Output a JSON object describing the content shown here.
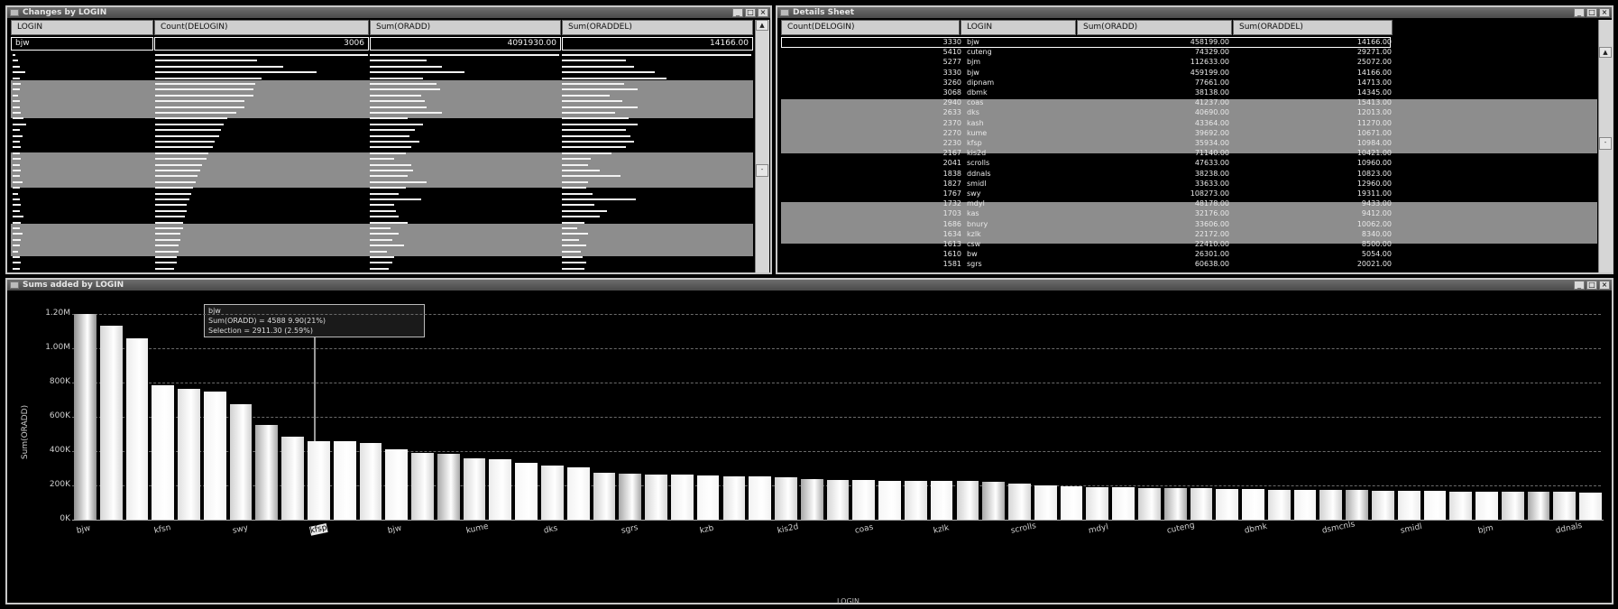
{
  "top_left": {
    "title": "Changes by LOGIN",
    "columns": [
      "LOGIN",
      "Count(DELOGIN)",
      "Sum(ORADD)",
      "Sum(ORADDEL)"
    ],
    "selected_row": [
      "bjw",
      "3006",
      "4091930.00",
      "14166.00"
    ],
    "bars": [
      [
        0.02,
        1.0,
        1.0,
        1.0
      ],
      [
        0.04,
        0.48,
        0.3,
        0.34
      ],
      [
        0.05,
        0.6,
        0.38,
        0.38
      ],
      [
        0.09,
        0.76,
        0.5,
        0.49
      ],
      [
        0.05,
        0.5,
        0.28,
        0.55
      ],
      [
        0.06,
        0.47,
        0.35,
        0.33
      ],
      [
        0.05,
        0.46,
        0.37,
        0.4
      ],
      [
        0.04,
        0.46,
        0.27,
        0.25
      ],
      [
        0.05,
        0.42,
        0.29,
        0.32
      ],
      [
        0.05,
        0.42,
        0.3,
        0.4
      ],
      [
        0.06,
        0.38,
        0.38,
        0.28
      ],
      [
        0.08,
        0.34,
        0.2,
        0.35
      ],
      [
        0.1,
        0.32,
        0.28,
        0.4
      ],
      [
        0.05,
        0.31,
        0.24,
        0.34
      ],
      [
        0.07,
        0.3,
        0.21,
        0.36
      ],
      [
        0.05,
        0.28,
        0.26,
        0.38
      ],
      [
        0.06,
        0.27,
        0.22,
        0.34
      ],
      [
        0.05,
        0.25,
        0.19,
        0.26
      ],
      [
        0.06,
        0.24,
        0.13,
        0.15
      ],
      [
        0.05,
        0.22,
        0.22,
        0.14
      ],
      [
        0.06,
        0.21,
        0.23,
        0.2
      ],
      [
        0.05,
        0.2,
        0.2,
        0.31
      ],
      [
        0.07,
        0.19,
        0.3,
        0.14
      ],
      [
        0.05,
        0.18,
        0.19,
        0.13
      ],
      [
        0.04,
        0.17,
        0.15,
        0.16
      ],
      [
        0.05,
        0.16,
        0.27,
        0.39
      ],
      [
        0.06,
        0.15,
        0.13,
        0.17
      ],
      [
        0.05,
        0.15,
        0.14,
        0.24
      ],
      [
        0.08,
        0.14,
        0.15,
        0.2
      ],
      [
        0.06,
        0.13,
        0.2,
        0.12
      ],
      [
        0.05,
        0.13,
        0.11,
        0.08
      ],
      [
        0.07,
        0.12,
        0.15,
        0.14
      ],
      [
        0.06,
        0.12,
        0.12,
        0.09
      ],
      [
        0.05,
        0.11,
        0.18,
        0.13
      ],
      [
        0.04,
        0.11,
        0.09,
        0.1
      ],
      [
        0.05,
        0.1,
        0.13,
        0.11
      ],
      [
        0.06,
        0.1,
        0.12,
        0.13
      ],
      [
        0.05,
        0.09,
        0.1,
        0.12
      ]
    ]
  },
  "top_right": {
    "title": "Details Sheet",
    "columns": [
      "Count(DELOGIN)",
      "LOGIN",
      "Sum(ORADD)",
      "Sum(ORADDEL)"
    ],
    "rows": [
      [
        "3330",
        "bjw",
        "458199.00",
        "14166.00"
      ],
      [
        "5410",
        "cuteng",
        "74329.00",
        "29271.00"
      ],
      [
        "5277",
        "bjm",
        "112633.00",
        "25072.00"
      ],
      [
        "3330",
        "bjw",
        "459199.00",
        "14166.00"
      ],
      [
        "3260",
        "dipnam",
        "77661.00",
        "14713.00"
      ],
      [
        "3068",
        "dbmk",
        "38138.00",
        "14345.00"
      ],
      [
        "2940",
        "coas",
        "41237.00",
        "15413.00"
      ],
      [
        "2633",
        "dks",
        "40690.00",
        "12013.00"
      ],
      [
        "2370",
        "kash",
        "43364.00",
        "11270.00"
      ],
      [
        "2270",
        "kume",
        "39692.00",
        "10671.00"
      ],
      [
        "2230",
        "kfsp",
        "35934.00",
        "10984.00"
      ],
      [
        "2167",
        "kis2d",
        "71140.00",
        "10421.00"
      ],
      [
        "2041",
        "scrolls",
        "47633.00",
        "10960.00"
      ],
      [
        "1838",
        "ddnals",
        "38238.00",
        "10823.00"
      ],
      [
        "1827",
        "smidl",
        "33633.00",
        "12960.00"
      ],
      [
        "1767",
        "swy",
        "108273.00",
        "19311.00"
      ],
      [
        "1732",
        "mdyl",
        "48178.00",
        "9433.00"
      ],
      [
        "1703",
        "kas",
        "32176.00",
        "9412.00"
      ],
      [
        "1686",
        "bnury",
        "33606.00",
        "10062.00"
      ],
      [
        "1634",
        "kzlk",
        "22172.00",
        "8340.00"
      ],
      [
        "1613",
        "csw",
        "22410.00",
        "8500.00"
      ],
      [
        "1610",
        "bw",
        "26301.00",
        "5054.00"
      ],
      [
        "1581",
        "sgrs",
        "60638.00",
        "20021.00"
      ]
    ]
  },
  "chart_window": {
    "title": "Sums added by LOGIN",
    "tooltip": {
      "line1": "bjw",
      "line2": "Sum(ORADD) = 4588 9.90(21%)",
      "line3": "Selection = 2911.30 (2.59%)"
    },
    "highlight_label": "bjw"
  },
  "chart_data": {
    "type": "bar",
    "ylabel": "Sum(ORADD)",
    "xlabel": "LOGIN",
    "ylim": [
      0,
      1200000
    ],
    "yticks": [
      "0K",
      "200K",
      "400K",
      "600K",
      "800K",
      "1.00M",
      "1.20M"
    ],
    "ytick_values": [
      0,
      200000,
      400000,
      600000,
      800000,
      1000000,
      1200000
    ],
    "x_tick_labels": [
      "bjw",
      "kfsn",
      "swy",
      "kfsp",
      "bjw",
      "kume",
      "dks",
      "sgrs",
      "kzb",
      "kis2d",
      "coas",
      "kzlk",
      "scrolls",
      "mdyl",
      "cuteng",
      "dbmk",
      "dsmcnls",
      "smidl",
      "bjm",
      "ddnals"
    ],
    "highlight_index": 8,
    "values": [
      1200000,
      1130000,
      1060000,
      785000,
      765000,
      750000,
      675000,
      555000,
      485000,
      460000,
      460000,
      445000,
      410000,
      392000,
      385000,
      360000,
      355000,
      332000,
      315000,
      305000,
      275000,
      270000,
      265000,
      263000,
      257000,
      255000,
      253000,
      250000,
      235000,
      232000,
      230000,
      228000,
      227000,
      226000,
      224000,
      222000,
      212000,
      202000,
      195000,
      192000,
      187000,
      185000,
      183000,
      182000,
      180000,
      178000,
      176000,
      175000,
      173000,
      172000,
      170000,
      168000,
      167000,
      165000,
      164000,
      163000,
      162000,
      161000,
      160000
    ]
  }
}
